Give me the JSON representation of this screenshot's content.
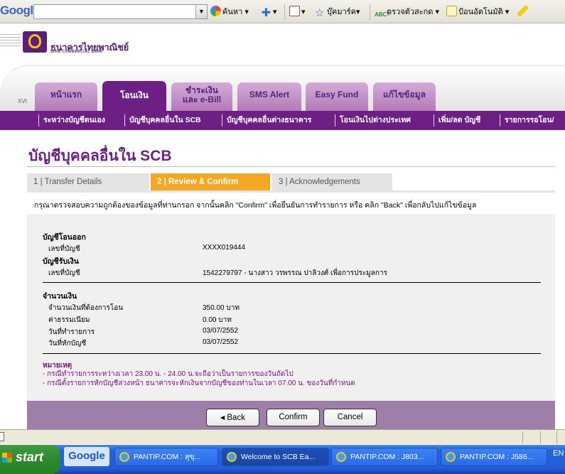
{
  "toolbar": {
    "logo": "Google",
    "search_value": "",
    "search_button": "ค้นหา",
    "bookmarks": "บุ๊คมาร์ค",
    "spellcheck": "ตรวจตัวสะกด",
    "autofill": "ป้อนอัตโนมัติ"
  },
  "bank": {
    "name_th": "ธนาคารไทยพาณิชย์",
    "name_en": "SIAM COMMERCIAL BANK",
    "accent": "#6e1f86",
    "orange": "#f5a623"
  },
  "nav": {
    "xvi": "XVI",
    "tabs": [
      {
        "label": "หน้าแรก"
      },
      {
        "label": "โอนเงิน",
        "active": true
      },
      {
        "label": "ชำระเงิน",
        "label2": "และ e-Bill"
      },
      {
        "label": "SMS Alert"
      },
      {
        "label": "Easy Fund"
      },
      {
        "label": "แก้ไขข้อมูล"
      }
    ],
    "submenu": [
      "ระหว่างบัญชีตนเอง",
      "บัญชีบุคคลอื่นใน SCB",
      "บัญชีบุคคลอื่นต่างธนาคาร",
      "โอนเงินไปต่างประเทศ",
      "เพิ่ม/ลด บัญชี",
      "รายการรอโอน/"
    ]
  },
  "page": {
    "title": "บัญชีบุคคลอื่นใน SCB",
    "steps": [
      "1 | Transfer Details",
      "2 | Review & Confirm",
      "3 | Acknowledgements"
    ],
    "instruction": "กรุณาตรวจสอบความถูกต้องของข้อมูลที่ท่านกรอก จากนั้นคลิก \"Confirm\" เพื่อยืนยันการทำรายการ หรือ คลิก \"Back\" เพื่อกลับไปแก้ไขข้อมูล"
  },
  "details": {
    "from_heading": "บัญชีโอนออก",
    "from_label": "เลขที่บัญชี",
    "from_value": "XXXX019444",
    "to_heading": "บัญชีรับเงิน",
    "to_label": "เลขที่บัญชี",
    "to_value": "1542279797 - นางสาว วรพรรณ ปาลิวงศ์ เพื่อการประมูลการ",
    "amount_heading": "จำนวนเงิน",
    "rows": [
      {
        "label": "จำนวนเงินที่ต้องการโอน",
        "value": "350.00 บาท"
      },
      {
        "label": "ค่าธรรมเนียม",
        "value": "0.00 บาท"
      },
      {
        "label": "วันที่ทำรายการ",
        "value": "03/07/2552"
      },
      {
        "label": "วันที่หักบัญชี",
        "value": "03/07/2552"
      }
    ],
    "note_heading": "หมายเหตุ",
    "notes": [
      "- กรณีทำรายการระหว่างเวลา 23.00 น. - 24.00 น.จะถือว่าเป็นรายการของวันถัดไป",
      "- กรณีตั้งรายการหักบัญชีล่วงหน้า ธนาคารจะหักเงินจากบัญชีของท่านในเวลา 07.00 น. ของวันที่กำหนด"
    ]
  },
  "buttons": {
    "back": "Back",
    "confirm": "Confirm",
    "cancel": "Cancel"
  },
  "taskbar": {
    "start": "start",
    "google": "Google",
    "tasks": [
      "PANTIP.COM : สุขุ...",
      "Welcome to SCB Ea...",
      "PANTIP.COM : J803...",
      "PANTIP.COM : J586..."
    ],
    "lang": "EN"
  }
}
